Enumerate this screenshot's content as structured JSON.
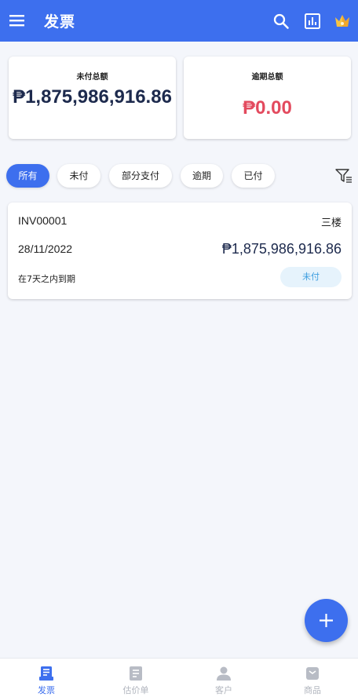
{
  "appbar": {
    "title": "发票",
    "icons": [
      "menu-icon",
      "search-icon",
      "report-icon",
      "crown-icon"
    ],
    "color": "#3d6fee"
  },
  "summary": {
    "unpaid_label": "未付总额",
    "unpaid_value": "₱1,875,986,916.86",
    "overdue_label": "逾期总额",
    "overdue_value": "₱0.00"
  },
  "filters": {
    "selected": "所有",
    "chips": [
      "所有",
      "未付",
      "部分支付",
      "逾期",
      "已付"
    ]
  },
  "invoices": [
    {
      "number": "INV00001",
      "client": "三楼",
      "date": "28/11/2022",
      "amount": "₱1,875,986,916.86",
      "due": "在7天之内到期",
      "status": "未付"
    }
  ],
  "bottom_nav": {
    "items": [
      "发票",
      "估价单",
      "客户",
      "商品"
    ],
    "active": "发票"
  },
  "colors": {
    "accent": "#3d6fee",
    "overdue": "#e34a5e",
    "status_unpaid_bg": "#e6f3fc",
    "status_unpaid_text": "#3f9fe0"
  }
}
